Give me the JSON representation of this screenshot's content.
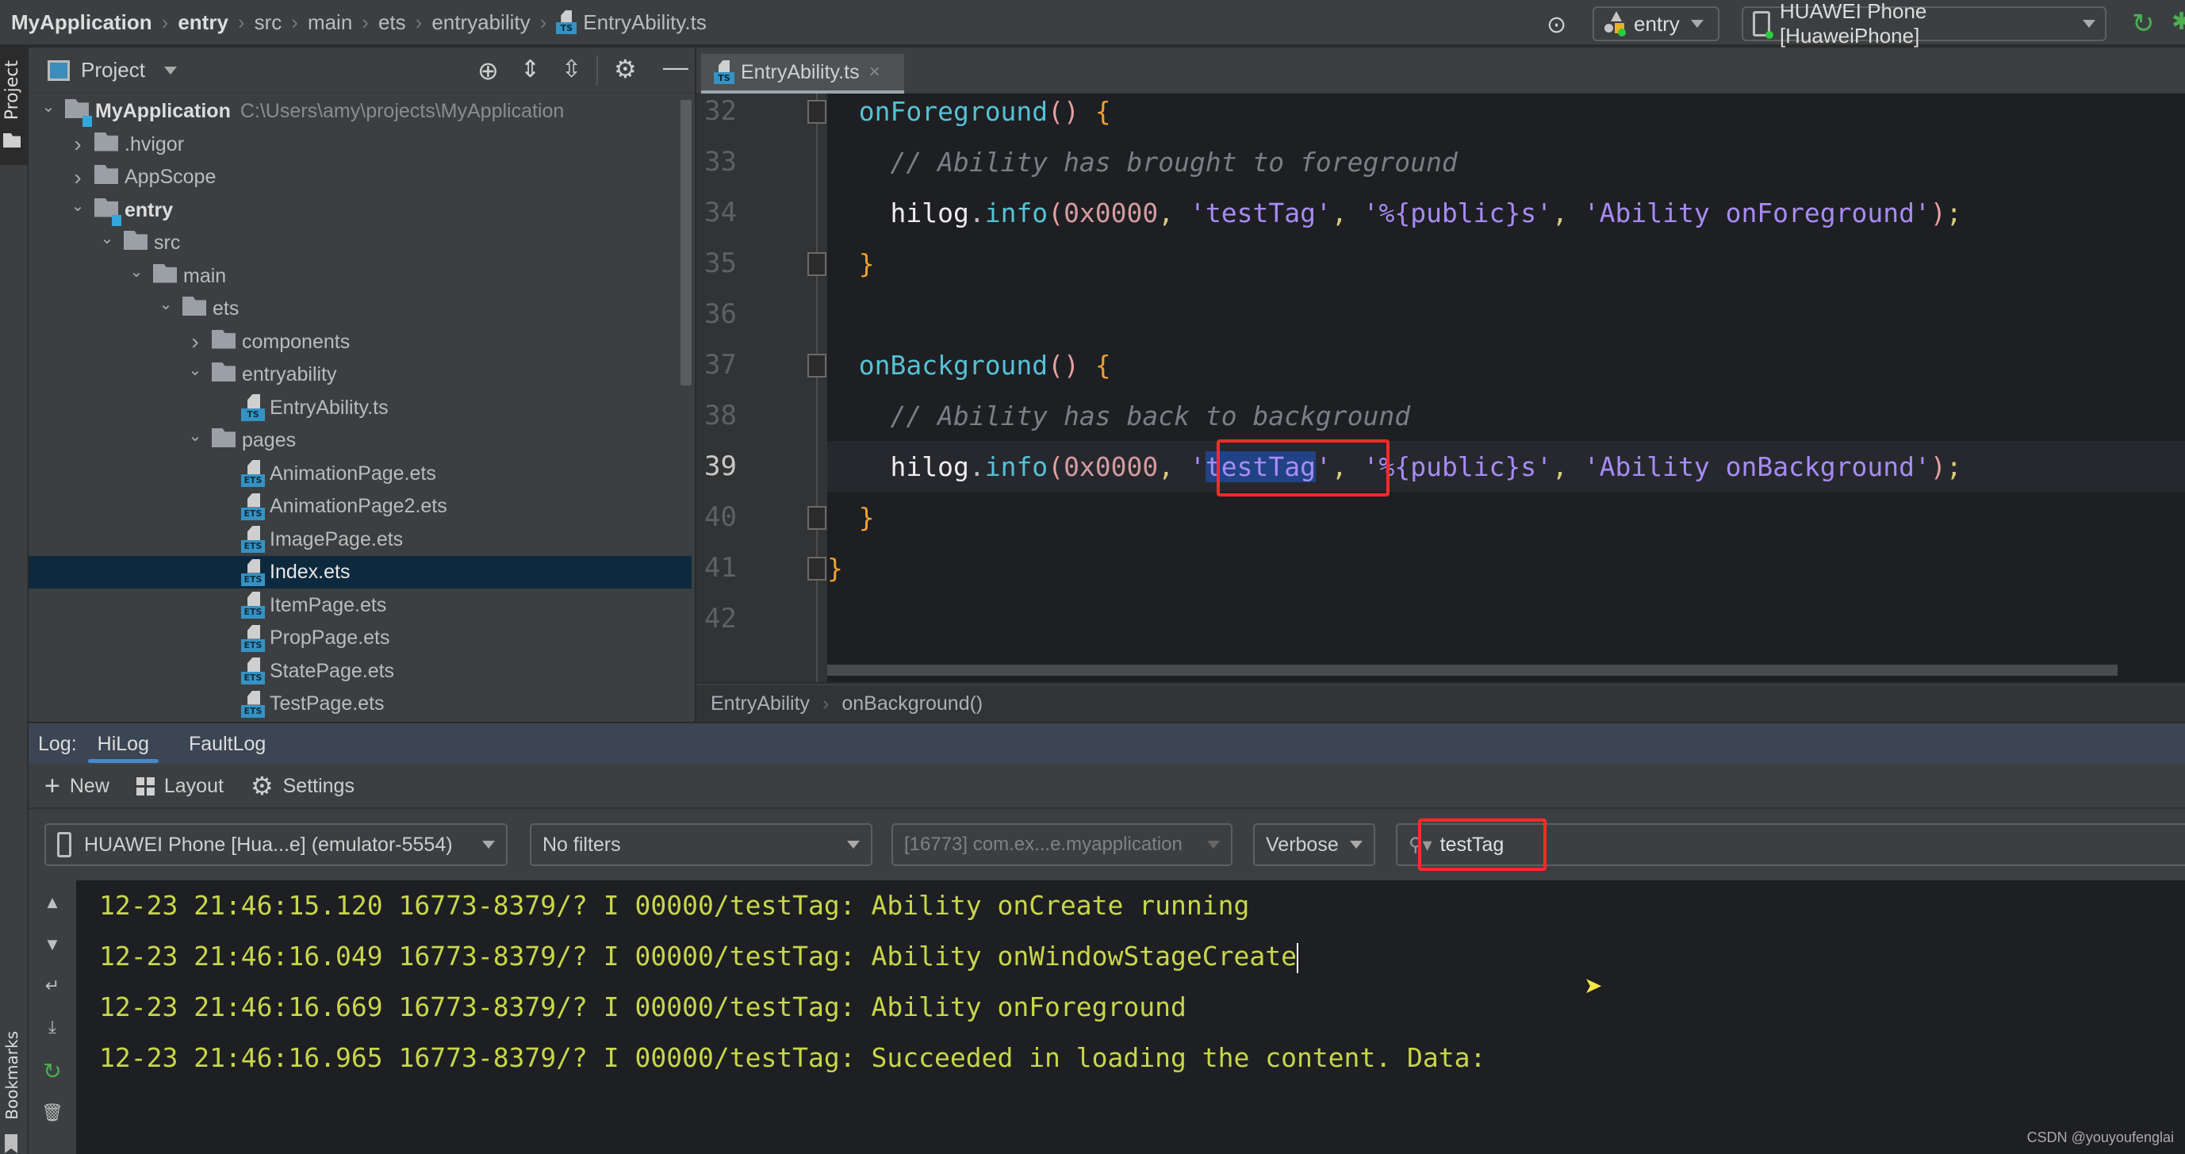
{
  "nav_breadcrumb": {
    "items": [
      "MyApplication",
      "entry",
      "src",
      "main",
      "ets",
      "entryability",
      "EntryAbility.ts"
    ]
  },
  "toolbar": {
    "run_config": "entry",
    "device": "HUAWEI Phone [HuaweiPhone]",
    "icons": [
      "target-icon",
      "rerun-icon",
      "debug-icon"
    ]
  },
  "left_strip": {
    "project_label": "Project",
    "bookmarks_label": "Bookmarks"
  },
  "project_panel": {
    "title": "Project",
    "tree": [
      {
        "label": "MyApplication",
        "path": "C:\\Users\\amy\\projects\\MyApplication",
        "type": "module",
        "expanded": true,
        "depth": 0
      },
      {
        "label": ".hvigor",
        "type": "folder",
        "expanded": false,
        "depth": 1
      },
      {
        "label": "AppScope",
        "type": "folder",
        "expanded": false,
        "depth": 1
      },
      {
        "label": "entry",
        "type": "module",
        "expanded": true,
        "depth": 1
      },
      {
        "label": "src",
        "type": "folder",
        "expanded": true,
        "depth": 2
      },
      {
        "label": "main",
        "type": "folder",
        "expanded": true,
        "depth": 3
      },
      {
        "label": "ets",
        "type": "folder",
        "expanded": true,
        "depth": 4
      },
      {
        "label": "components",
        "type": "folder",
        "expanded": false,
        "depth": 5
      },
      {
        "label": "entryability",
        "type": "folder",
        "expanded": true,
        "depth": 5
      },
      {
        "label": "EntryAbility.ts",
        "type": "ts",
        "depth": 6
      },
      {
        "label": "pages",
        "type": "folder",
        "expanded": true,
        "depth": 5
      },
      {
        "label": "AnimationPage.ets",
        "type": "ets",
        "depth": 6
      },
      {
        "label": "AnimationPage2.ets",
        "type": "ets",
        "depth": 6
      },
      {
        "label": "ImagePage.ets",
        "type": "ets",
        "depth": 6
      },
      {
        "label": "Index.ets",
        "type": "ets",
        "depth": 6,
        "selected": true
      },
      {
        "label": "ItemPage.ets",
        "type": "ets",
        "depth": 6
      },
      {
        "label": "PropPage.ets",
        "type": "ets",
        "depth": 6
      },
      {
        "label": "StatePage.ets",
        "type": "ets",
        "depth": 6
      },
      {
        "label": "TestPage.ets",
        "type": "ets",
        "depth": 6
      }
    ]
  },
  "editor": {
    "tab": {
      "label": "EntryAbility.ts",
      "close": "×"
    },
    "current_line": 39,
    "lines": [
      {
        "n": "32",
        "tokens": [
          [
            "  ",
            ""
          ],
          [
            "onForeground",
            "c-fn"
          ],
          [
            "()",
            "c-paren"
          ],
          [
            " {",
            "c-brace"
          ]
        ],
        "fold": "open"
      },
      {
        "n": "33",
        "tokens": [
          [
            "    ",
            ""
          ],
          [
            "// Ability has brought to foreground",
            "c-cm"
          ]
        ]
      },
      {
        "n": "34",
        "tokens": [
          [
            "    ",
            ""
          ],
          [
            "hilog",
            "c-id"
          ],
          [
            ".",
            "c-dot"
          ],
          [
            "info",
            "c-fn"
          ],
          [
            "(",
            "c-paren"
          ],
          [
            "0x0000",
            "c-num"
          ],
          [
            ", ",
            "c-punc"
          ],
          [
            "'testTag'",
            "c-str"
          ],
          [
            ", ",
            "c-punc"
          ],
          [
            "'%{public}s'",
            "c-str"
          ],
          [
            ", ",
            "c-punc"
          ],
          [
            "'Ability onForeground'",
            "c-str"
          ],
          [
            ")",
            "c-paren"
          ],
          [
            ";",
            "c-punc"
          ]
        ]
      },
      {
        "n": "35",
        "tokens": [
          [
            "  ",
            ""
          ],
          [
            "}",
            "c-brace"
          ]
        ],
        "fold": "close"
      },
      {
        "n": "36",
        "tokens": []
      },
      {
        "n": "37",
        "tokens": [
          [
            "  ",
            ""
          ],
          [
            "onBackground",
            "c-fn"
          ],
          [
            "()",
            "c-paren"
          ],
          [
            " {",
            "c-brace"
          ]
        ],
        "fold": "open"
      },
      {
        "n": "38",
        "tokens": [
          [
            "    ",
            ""
          ],
          [
            "// Ability has back to background",
            "c-cm"
          ]
        ]
      },
      {
        "n": "39",
        "tokens": [
          [
            "    ",
            ""
          ],
          [
            "hilog",
            "c-id"
          ],
          [
            ".",
            "c-dot"
          ],
          [
            "info",
            "c-fn"
          ],
          [
            "(",
            "c-paren"
          ],
          [
            "0x0000",
            "c-num"
          ],
          [
            ", ",
            "c-punc"
          ],
          [
            "'",
            "c-str"
          ],
          [
            "testTag",
            "c-str sel-hl"
          ],
          [
            "'",
            "c-str"
          ],
          [
            ", ",
            "c-punc"
          ],
          [
            "'%{public}s'",
            "c-str"
          ],
          [
            ", ",
            "c-punc"
          ],
          [
            "'Ability onBackground'",
            "c-str"
          ],
          [
            ")",
            "c-paren"
          ],
          [
            ";",
            "c-punc"
          ]
        ]
      },
      {
        "n": "40",
        "tokens": [
          [
            "  ",
            ""
          ],
          [
            "}",
            "c-brace"
          ]
        ],
        "fold": "close"
      },
      {
        "n": "41",
        "tokens": [
          [
            "}",
            "c-brace"
          ]
        ],
        "fold": "close"
      },
      {
        "n": "42",
        "tokens": []
      }
    ],
    "breadcrumb": [
      "EntryAbility",
      "onBackground()"
    ]
  },
  "log_panel": {
    "prefix": "Log:",
    "tabs": [
      {
        "label": "HiLog",
        "active": true
      },
      {
        "label": "FaultLog",
        "active": false
      }
    ],
    "toolbar": {
      "new": "New",
      "layout": "Layout",
      "settings": "Settings"
    },
    "filters": {
      "device": "HUAWEI Phone [Hua...e] (emulator-5554)",
      "filter": "No filters",
      "process": "[16773] com.ex...e.myapplication",
      "level": "Verbose",
      "search": "testTag"
    },
    "lines": [
      "12-23 21:46:15.120 16773-8379/? I 00000/testTag: Ability onCreate running",
      "12-23 21:46:16.049 16773-8379/? I 00000/testTag: Ability onWindowStageCreate",
      "12-23 21:46:16.669 16773-8379/? I 00000/testTag: Ability onForeground",
      "12-23 21:46:16.965 16773-8379/? I 00000/testTag: Succeeded in loading the content. Data:"
    ]
  },
  "watermark": "CSDN @youyoufenglai",
  "colors": {
    "highlight_box": "#ff2a2a",
    "selection": "#214283",
    "log_text": "#c8d64a",
    "tab_underline": "#4a88c7"
  }
}
